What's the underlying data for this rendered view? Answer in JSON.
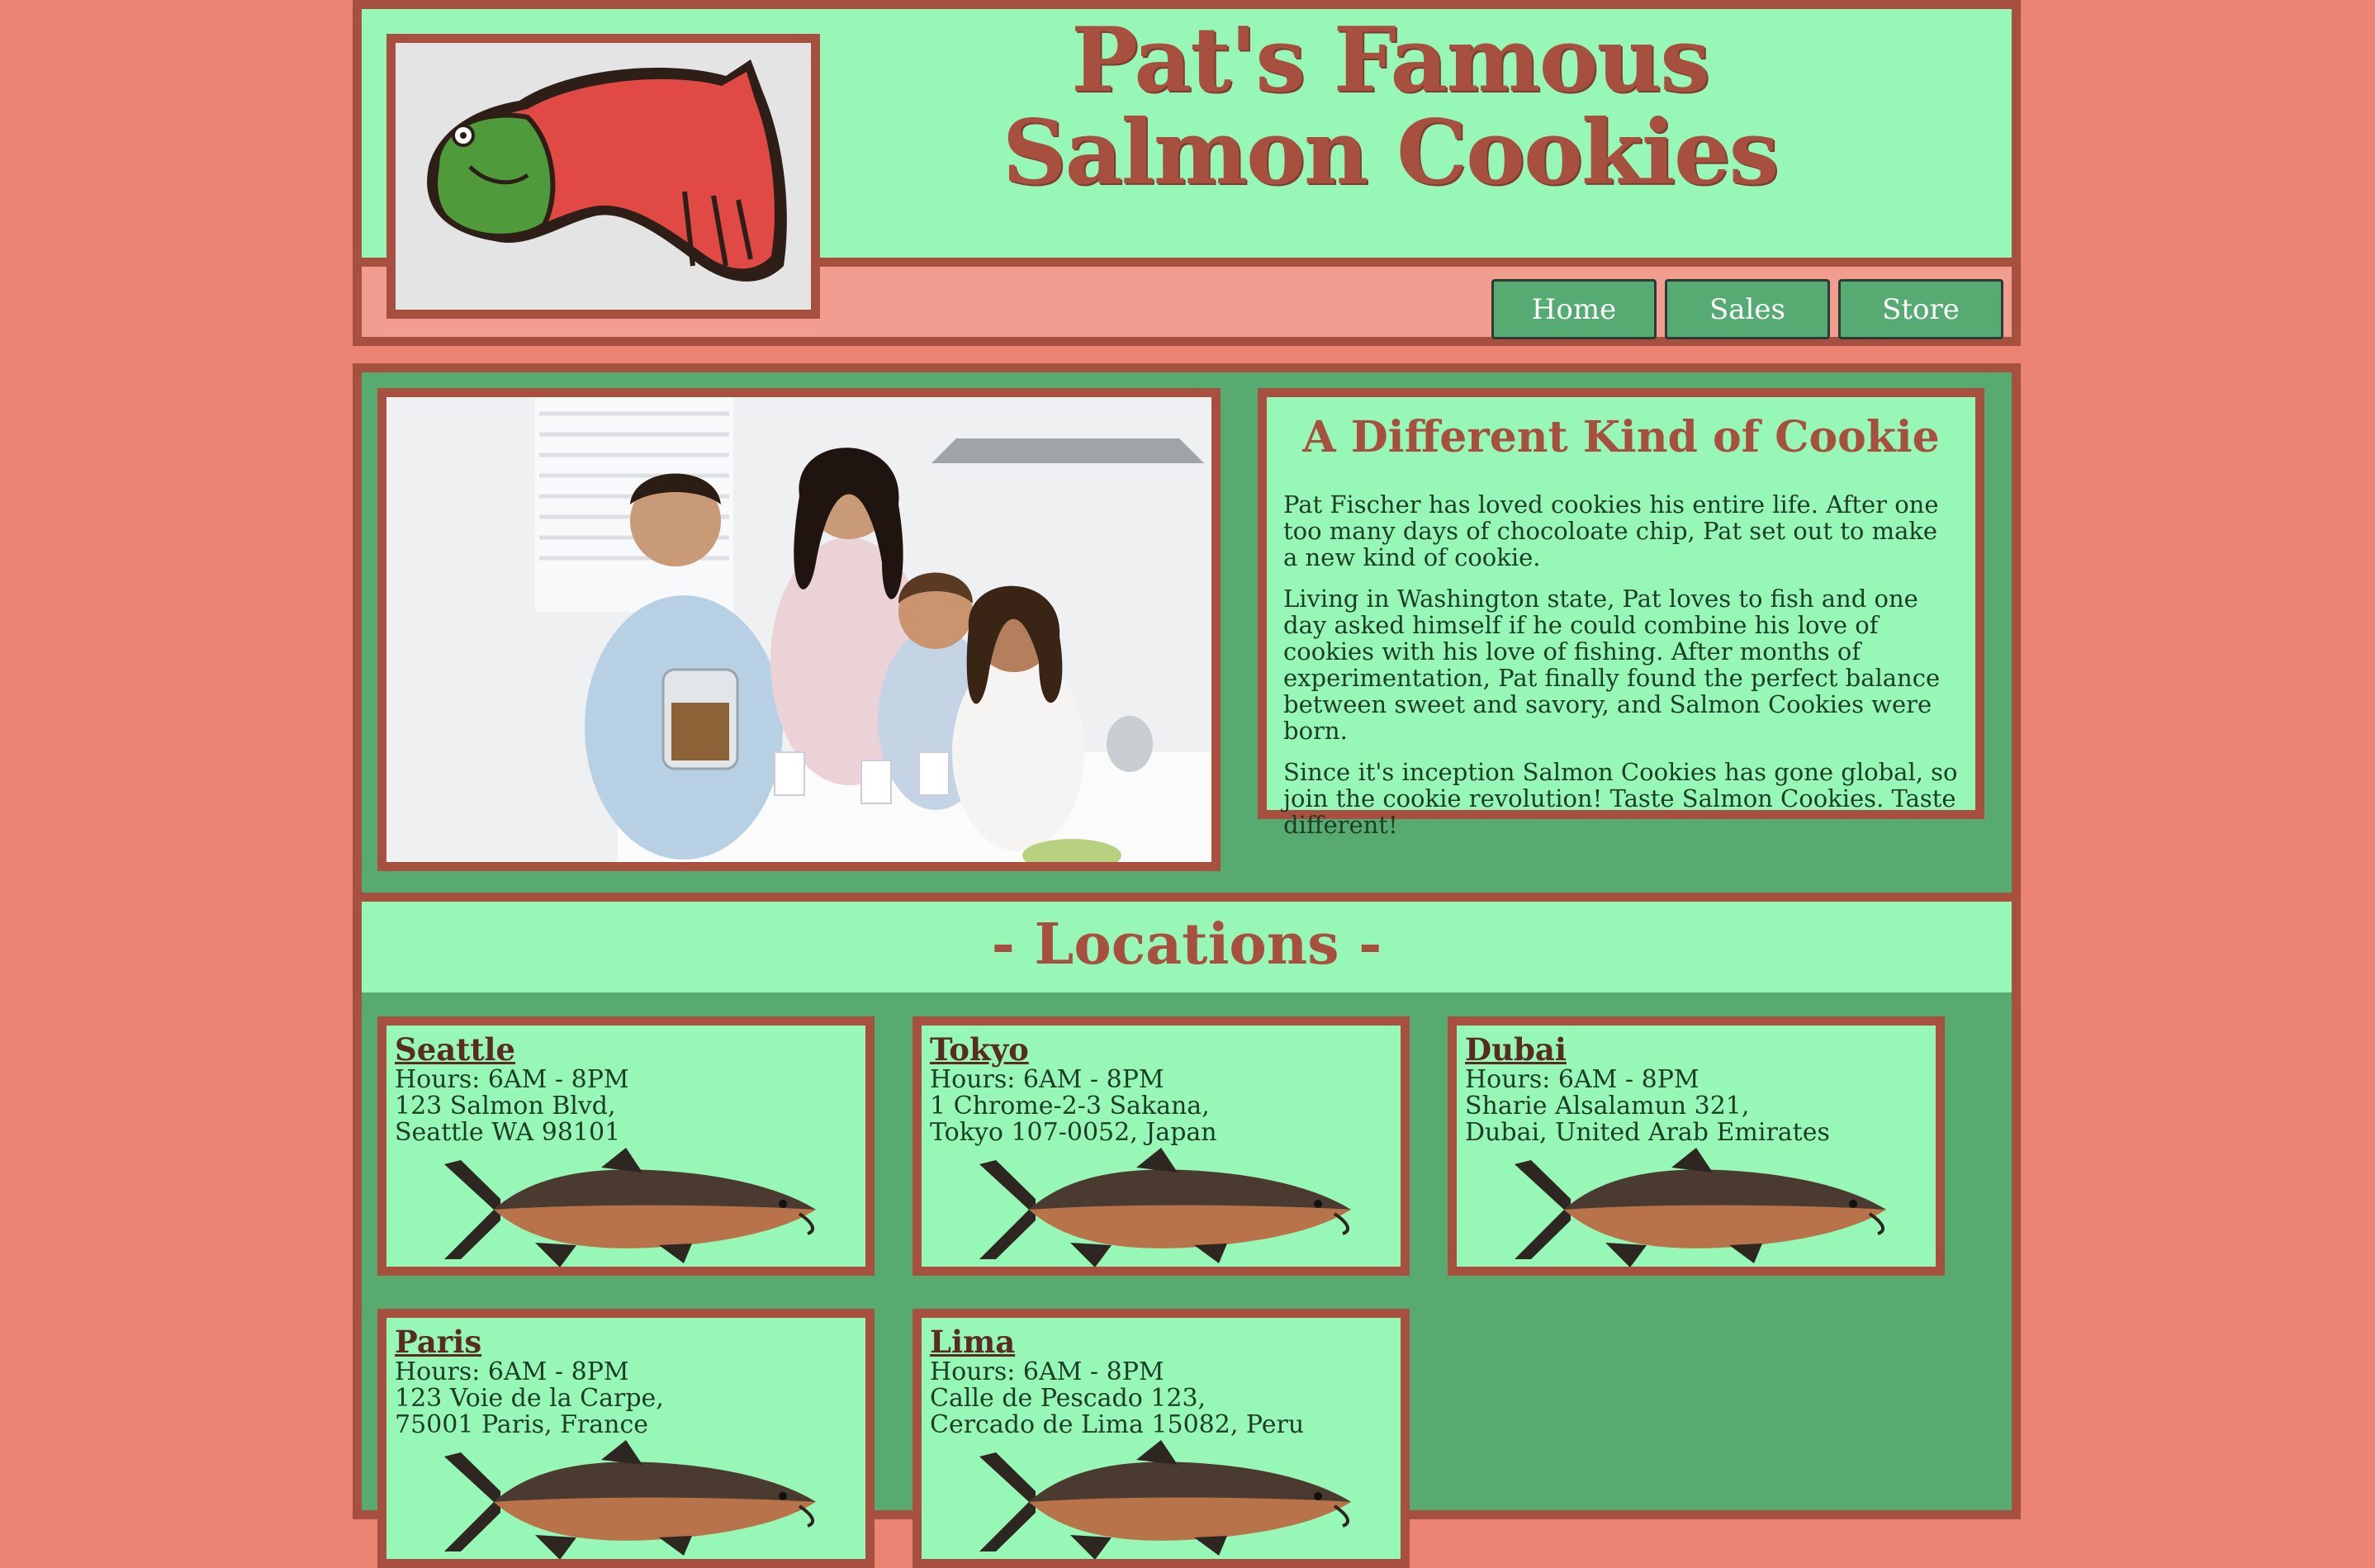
{
  "header": {
    "title_line1": "Pat's Famous",
    "title_line2": "Salmon Cookies",
    "nav": [
      "Home",
      "Sales",
      "Store"
    ]
  },
  "about": {
    "title": "A Different Kind of Cookie",
    "paragraphs": [
      "Pat Fischer has loved cookies his entire life. After one too many days of chocoloate chip, Pat set out to make a new kind of cookie.",
      "Living in Washington state, Pat loves to fish and one day asked himself if he could combine his love of cookies with his love of fishing. After months of experimentation, Pat finally found the perfect balance between sweet and savory, and Salmon Cookies were born.",
      "Since it's inception Salmon Cookies has gone global, so join the cookie revolution! Taste Salmon Cookies. Taste different!"
    ]
  },
  "locations": {
    "title": "- Locations -",
    "stores": [
      {
        "name": "Seattle",
        "hours": "Hours: 6AM - 8PM",
        "address1": "123 Salmon Blvd,",
        "address2": "Seattle WA 98101"
      },
      {
        "name": "Tokyo",
        "hours": "Hours: 6AM - 8PM",
        "address1": "1 Chrome-2-3 Sakana,",
        "address2": "Tokyo 107-0052, Japan"
      },
      {
        "name": "Dubai",
        "hours": "Hours: 6AM - 8PM",
        "address1": "Sharie Alsalamun 321,",
        "address2": "Dubai, United Arab Emirates"
      },
      {
        "name": "Paris",
        "hours": "Hours: 6AM - 8PM",
        "address1": "123 Voie de la Carpe,",
        "address2": "75001 Paris, France"
      },
      {
        "name": "Lima",
        "hours": "Hours: 6AM - 8PM",
        "address1": "Calle de Pescado 123,",
        "address2": "Cercado de Lima 15082, Peru"
      }
    ]
  },
  "colors": {
    "page_bg": "#ec8474",
    "border": "#a8503f",
    "mint": "#97f7b6",
    "green": "#57ab70",
    "salmon_band": "#f19d90"
  },
  "icons": {
    "logo": "salmon-cookie-image",
    "fish": "salmon-fish-image",
    "hero": "family-photo"
  }
}
